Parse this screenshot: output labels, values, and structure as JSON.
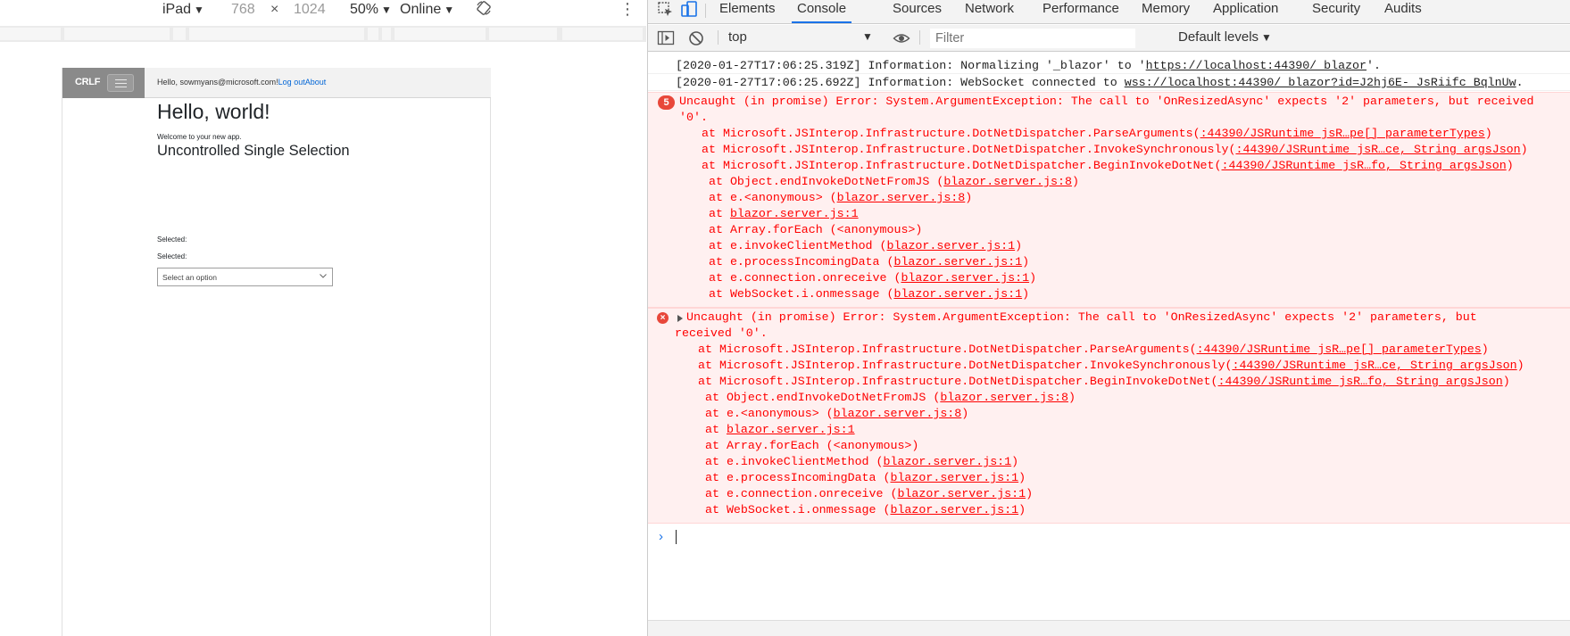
{
  "device_toolbar": {
    "device": "iPad",
    "width": "768",
    "times": "×",
    "height": "1024",
    "zoom": "50%",
    "throttle": "Online"
  },
  "app": {
    "brand": "CRLF",
    "greeting": "Hello, sowmyans@microsoft.com!",
    "logout": "Log out",
    "about": "About",
    "heading": "Hello, world!",
    "welcome": "Welcome to your new app.",
    "subheading": "Uncontrolled Single Selection",
    "selected_label_1": "Selected:",
    "selected_label_2": "Selected:",
    "dropdown_placeholder": "Select an option"
  },
  "devtools": {
    "tabs": [
      "Elements",
      "Console",
      "Sources",
      "Network",
      "Performance",
      "Memory",
      "Application",
      "Security",
      "Audits"
    ],
    "active_tab": "Console",
    "context": "top",
    "filter_placeholder": "Filter",
    "levels": "Default levels"
  },
  "console": {
    "info": [
      {
        "prefix": "[2020-01-27T17:06:25.319Z] Information: Normalizing '_blazor' to '",
        "link": "https://localhost:44390/_blazor",
        "suffix": "'."
      },
      {
        "prefix": "[2020-01-27T17:06:25.692Z] Information: WebSocket connected to ",
        "link": "wss://localhost:44390/_blazor?id=J2hj6E-_JsRiifc_BqlnUw",
        "suffix": "."
      }
    ],
    "errors": [
      {
        "count": "5",
        "title_1": "Uncaught (in promise) Error: System.ArgumentException: The call to 'OnResizedAsync' expects '2' parameters, but received",
        "title_2": "'0'.",
        "frames": [
          {
            "pre": "at Microsoft.JSInterop.Infrastructure.DotNetDispatcher.ParseArguments(",
            "link": ":44390/JSRuntime_jsR…pe[]_parameterTypes",
            "post": ")"
          },
          {
            "pre": "at Microsoft.JSInterop.Infrastructure.DotNetDispatcher.InvokeSynchronously(",
            "link": ":44390/JSRuntime_jsR…ce,_String_argsJson",
            "post": ")"
          },
          {
            "pre": "at Microsoft.JSInterop.Infrastructure.DotNetDispatcher.BeginInvokeDotNet(",
            "link": ":44390/JSRuntime_jsR…fo,_String_argsJson",
            "post": ")"
          },
          {
            "pre": "at Object.endInvokeDotNetFromJS (",
            "link": "blazor.server.js:8",
            "post": ")"
          },
          {
            "pre": "at e.<anonymous> (",
            "link": "blazor.server.js:8",
            "post": ")"
          },
          {
            "pre": "at ",
            "link": "blazor.server.js:1",
            "post": ""
          },
          {
            "pre": "at Array.forEach (<anonymous>)",
            "link": "",
            "post": ""
          },
          {
            "pre": "at e.invokeClientMethod (",
            "link": "blazor.server.js:1",
            "post": ")"
          },
          {
            "pre": "at e.processIncomingData (",
            "link": "blazor.server.js:1",
            "post": ")"
          },
          {
            "pre": "at e.connection.onreceive (",
            "link": "blazor.server.js:1",
            "post": ")"
          },
          {
            "pre": "at WebSocket.i.onmessage (",
            "link": "blazor.server.js:1",
            "post": ")"
          }
        ]
      },
      {
        "count": "",
        "title_1": "Uncaught (in promise) Error: System.ArgumentException: The call to 'OnResizedAsync' expects '2' parameters, but",
        "title_2": "received '0'.",
        "frames": [
          {
            "pre": "at Microsoft.JSInterop.Infrastructure.DotNetDispatcher.ParseArguments(",
            "link": ":44390/JSRuntime_jsR…pe[]_parameterTypes",
            "post": ")"
          },
          {
            "pre": "at Microsoft.JSInterop.Infrastructure.DotNetDispatcher.InvokeSynchronously(",
            "link": ":44390/JSRuntime_jsR…ce,_String_argsJson",
            "post": ")"
          },
          {
            "pre": "at Microsoft.JSInterop.Infrastructure.DotNetDispatcher.BeginInvokeDotNet(",
            "link": ":44390/JSRuntime_jsR…fo,_String_argsJson",
            "post": ")"
          },
          {
            "pre": "at Object.endInvokeDotNetFromJS (",
            "link": "blazor.server.js:8",
            "post": ")"
          },
          {
            "pre": "at e.<anonymous> (",
            "link": "blazor.server.js:8",
            "post": ")"
          },
          {
            "pre": "at ",
            "link": "blazor.server.js:1",
            "post": ""
          },
          {
            "pre": "at Array.forEach (<anonymous>)",
            "link": "",
            "post": ""
          },
          {
            "pre": "at e.invokeClientMethod (",
            "link": "blazor.server.js:1",
            "post": ")"
          },
          {
            "pre": "at e.processIncomingData (",
            "link": "blazor.server.js:1",
            "post": ")"
          },
          {
            "pre": "at e.connection.onreceive (",
            "link": "blazor.server.js:1",
            "post": ")"
          },
          {
            "pre": "at WebSocket.i.onmessage (",
            "link": "blazor.server.js:1",
            "post": ")"
          }
        ]
      }
    ],
    "prompt_symbol": "›"
  },
  "colors": {
    "accent": "#1a73e8",
    "error_text": "#ff0000",
    "error_bg": "#fff0f0",
    "error_badge": "#e8473a",
    "app_sidebar": "#8a8a8a",
    "app_link": "#0366d6"
  },
  "icons": [
    "chevron-down-icon",
    "rotate-icon",
    "more-vertical-icon",
    "inspect-icon",
    "device-toggle-icon",
    "sidebar-toggle-icon",
    "clear-console-icon",
    "eye-icon",
    "hamburger-icon",
    "error-icon",
    "expand-triangle-icon",
    "prompt-icon"
  ]
}
